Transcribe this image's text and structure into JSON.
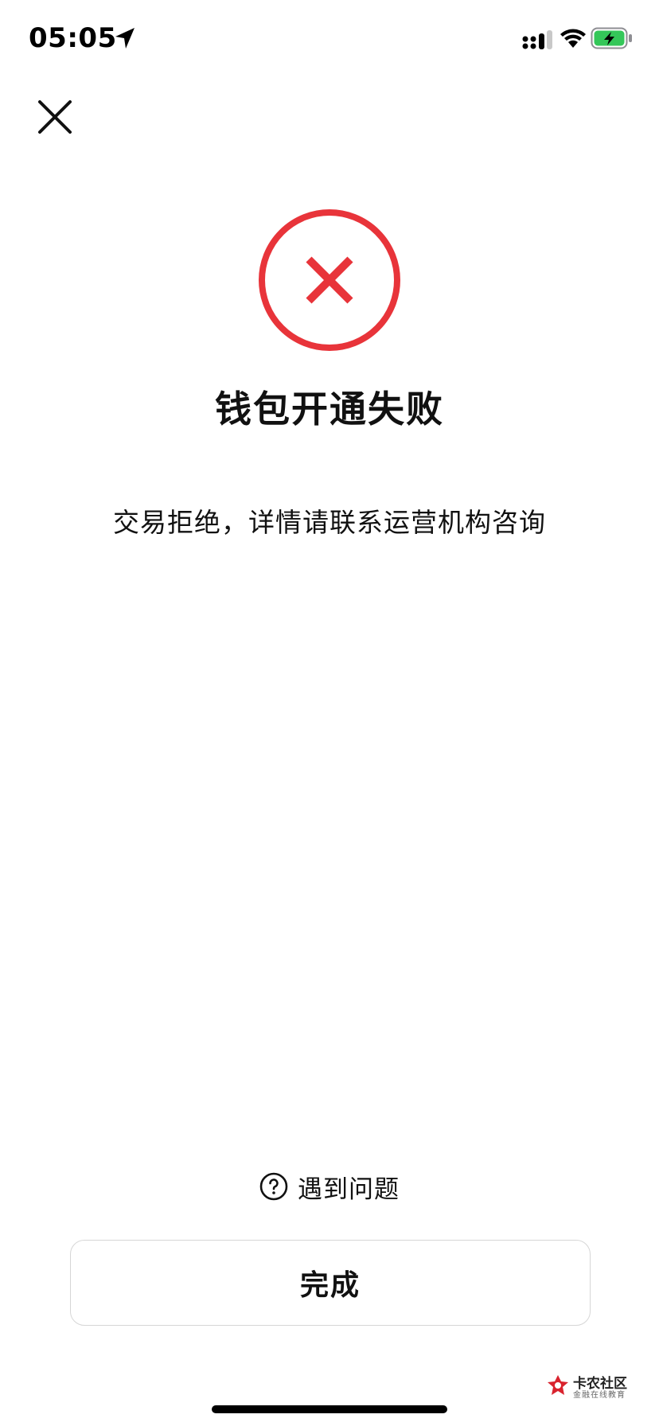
{
  "status_bar": {
    "time": "05:05",
    "icons": [
      "location-arrow-icon",
      "signal-icon",
      "wifi-icon",
      "battery-charging-icon"
    ],
    "battery_color": "#34c759"
  },
  "header": {
    "close_icon": "close-icon"
  },
  "result": {
    "icon": "error-circle-icon",
    "icon_color": "#e8343a",
    "title": "钱包开通失败",
    "message": "交易拒绝，详情请联系运营机构咨询"
  },
  "help": {
    "icon": "question-circle-icon",
    "label": "遇到问题"
  },
  "done_button": {
    "label": "完成"
  },
  "watermark": {
    "title": "卡农社区",
    "subtitle": "金融在线教育"
  }
}
